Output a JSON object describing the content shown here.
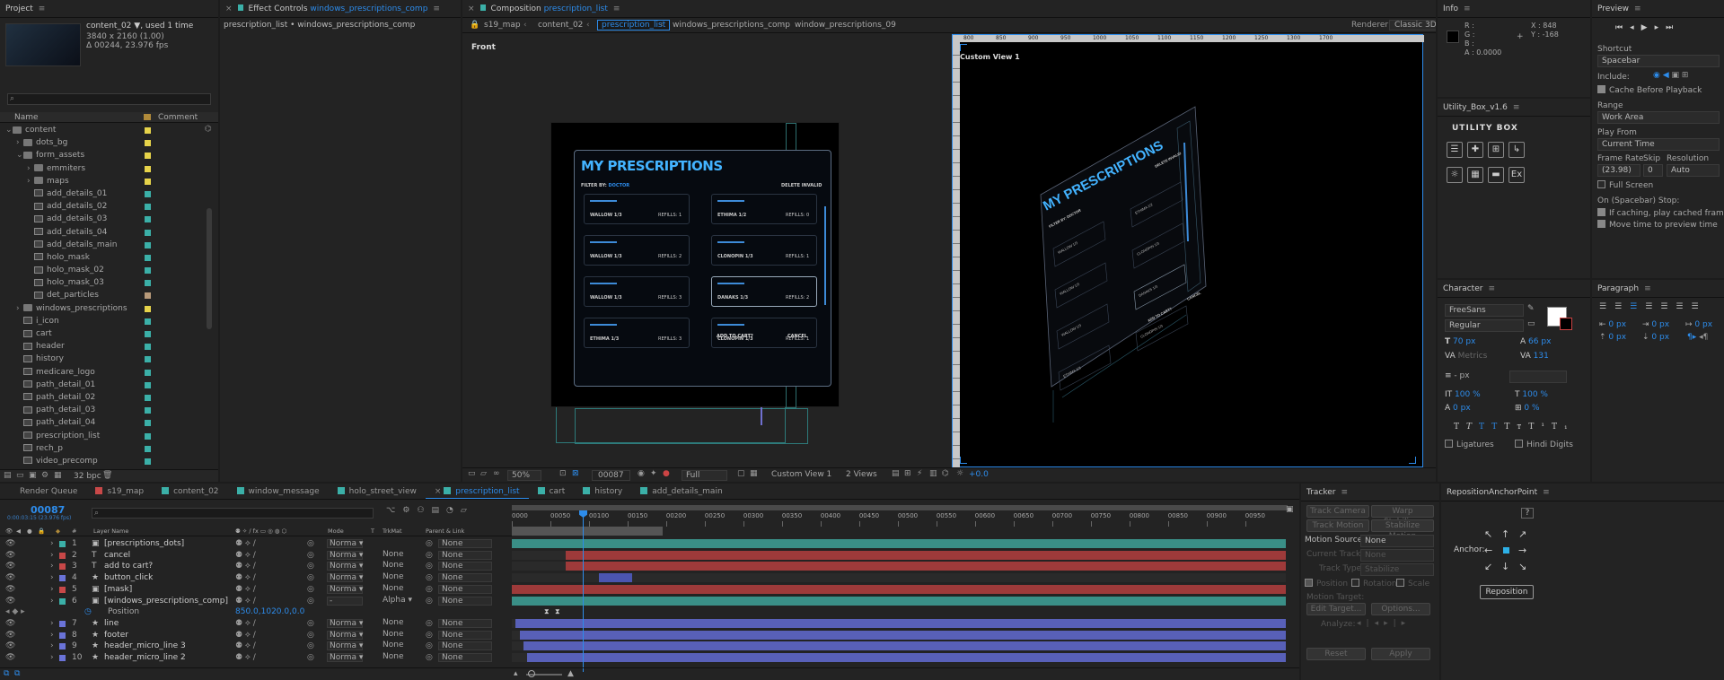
{
  "project": {
    "title": "Project",
    "item_name": "content_02 ▼",
    "used": ", used 1 time",
    "resolution": "3840 x 2160 (1.00)",
    "duration": "Δ 00244, 23.976 fps",
    "col_name": "Name",
    "col_comment": "Comment",
    "bpc": "32 bpc",
    "items": [
      {
        "label": "content",
        "indent": 0,
        "kind": "folder",
        "color": "#e6d34a",
        "open": true
      },
      {
        "label": "dots_bg",
        "indent": 1,
        "kind": "folder",
        "color": "#e6d34a"
      },
      {
        "label": "form_assets",
        "indent": 1,
        "kind": "folder",
        "color": "#e6d34a",
        "open": true
      },
      {
        "label": "emmiters",
        "indent": 2,
        "kind": "folder",
        "color": "#e6d34a"
      },
      {
        "label": "maps",
        "indent": 2,
        "kind": "folder",
        "color": "#e6d34a"
      },
      {
        "label": "add_details_01",
        "indent": 2,
        "kind": "comp",
        "color": "#3bb0a8"
      },
      {
        "label": "add_details_02",
        "indent": 2,
        "kind": "comp",
        "color": "#3bb0a8"
      },
      {
        "label": "add_details_03",
        "indent": 2,
        "kind": "comp",
        "color": "#3bb0a8"
      },
      {
        "label": "add_details_04",
        "indent": 2,
        "kind": "comp",
        "color": "#3bb0a8"
      },
      {
        "label": "add_details_main",
        "indent": 2,
        "kind": "comp",
        "color": "#3bb0a8"
      },
      {
        "label": "holo_mask",
        "indent": 2,
        "kind": "comp",
        "color": "#3bb0a8"
      },
      {
        "label": "holo_mask_02",
        "indent": 2,
        "kind": "comp",
        "color": "#3bb0a8"
      },
      {
        "label": "holo_mask_03",
        "indent": 2,
        "kind": "comp",
        "color": "#3bb0a8"
      },
      {
        "label": "det_particles",
        "indent": 2,
        "kind": "comp",
        "color": "#b89a7a"
      },
      {
        "label": "windows_prescriptions",
        "indent": 1,
        "kind": "folder",
        "color": "#e6d34a"
      },
      {
        "label": "i_icon",
        "indent": 1,
        "kind": "comp",
        "color": "#3bb0a8"
      },
      {
        "label": "cart",
        "indent": 1,
        "kind": "comp",
        "color": "#3bb0a8"
      },
      {
        "label": "header",
        "indent": 1,
        "kind": "comp",
        "color": "#3bb0a8"
      },
      {
        "label": "history",
        "indent": 1,
        "kind": "comp",
        "color": "#3bb0a8"
      },
      {
        "label": "medicare_logo",
        "indent": 1,
        "kind": "comp",
        "color": "#3bb0a8"
      },
      {
        "label": "path_detail_01",
        "indent": 1,
        "kind": "comp",
        "color": "#3bb0a8"
      },
      {
        "label": "path_detail_02",
        "indent": 1,
        "kind": "comp",
        "color": "#3bb0a8"
      },
      {
        "label": "path_detail_03",
        "indent": 1,
        "kind": "comp",
        "color": "#3bb0a8"
      },
      {
        "label": "path_detail_04",
        "indent": 1,
        "kind": "comp",
        "color": "#3bb0a8"
      },
      {
        "label": "prescription_list",
        "indent": 1,
        "kind": "comp",
        "color": "#3bb0a8"
      },
      {
        "label": "rech_p",
        "indent": 1,
        "kind": "comp",
        "color": "#3bb0a8"
      },
      {
        "label": "video_precomp",
        "indent": 1,
        "kind": "comp",
        "color": "#3bb0a8"
      }
    ]
  },
  "effect_controls": {
    "title": "Effect Controls",
    "comp": "windows_prescriptions_comp",
    "path": "prescription_list • windows_prescriptions_comp"
  },
  "composition": {
    "title": "Composition",
    "name": "prescription_list",
    "breadcrumbs": [
      "s19_map",
      "content_02",
      "prescription_list",
      "windows_prescriptions_comp",
      "window_prescriptions_09"
    ],
    "renderer_label": "Renderer",
    "renderer": "Classic 3D",
    "left_view": "Front",
    "right_view": "Custom View 1",
    "ruler": [
      "800",
      "850",
      "900",
      "950",
      "1000",
      "1050",
      "1100",
      "1150",
      "1200",
      "1250",
      "1300",
      "1700"
    ],
    "zoom": "50%",
    "frame": "00087",
    "quality": "Full",
    "view_select": "Custom View 1",
    "views": "2 Views",
    "exposure": "+0.0",
    "artwork": {
      "heading": "MY PRESCRIPTIONS",
      "filter": "FILTER BY:",
      "filter_value": "DOCTOR",
      "delete": "DELETE INVALID",
      "add_to_cart": "ADD TO CART?",
      "cancel": "CANCEL",
      "cards": [
        "WALLOW 1/3",
        "ETHIMA 1/2",
        "WALLOW 1/3",
        "CLONOPIN 1/3",
        "WALLOW 1/3",
        "DANAKS 1/3",
        "ETHIMA 1/3",
        "CLONOPIN 1/3"
      ],
      "refills": [
        "REFILLS: 1",
        "REFILLS: 0",
        "REFILLS: 2",
        "REFILLS: 1",
        "REFILLS: 3",
        "REFILLS: 2",
        "REFILLS: 3",
        "REFILLS: 1"
      ]
    }
  },
  "info": {
    "title": "Info",
    "r": "R :",
    "g": "G :",
    "b": "B :",
    "a": "A :",
    "a_val": "0.0000",
    "x": "X : 848",
    "y": "Y : -168"
  },
  "preview": {
    "title": "Preview",
    "shortcut_label": "Shortcut",
    "shortcut": "Spacebar",
    "include_label": "Include:",
    "cache": "Cache Before Playback",
    "range_label": "Range",
    "range": "Work Area",
    "play_from_label": "Play From",
    "play_from": "Current Time",
    "frame_rate_label": "Frame Rate",
    "skip_label": "Skip",
    "resolution_label": "Resolution",
    "frame_rate": "(23.98)",
    "skip": "0",
    "resolution": "Auto",
    "full_screen": "Full Screen",
    "on_stop": "On (Spacebar) Stop:",
    "if_caching": "If caching, play cached frames",
    "move_time": "Move time to preview time"
  },
  "utility": {
    "title": "Utility_Box_v1.6",
    "logo": "UTILITY BOX"
  },
  "character": {
    "title": "Character",
    "font": "FreeSans",
    "style": "Regular",
    "size": "70 px",
    "leading": "66 px",
    "kerning": "Metrics",
    "tracking": "131",
    "stroke": "- px",
    "vscale": "100 %",
    "hscale": "100 %",
    "baseline": "0 px",
    "tsume": "0 %",
    "ligatures": "Ligatures",
    "hindi": "Hindi Digits"
  },
  "paragraph": {
    "title": "Paragraph",
    "v1": "0 px",
    "v2": "0 px",
    "v3": "0 px",
    "v4": "0 px",
    "v5": "0 px"
  },
  "timeline": {
    "tabs": [
      {
        "label": "Render Queue",
        "color": ""
      },
      {
        "label": "s19_map",
        "color": "#c84848"
      },
      {
        "label": "content_02",
        "color": "#3bb0a8"
      },
      {
        "label": "window_message",
        "color": "#3bb0a8"
      },
      {
        "label": "holo_street_view",
        "color": "#3bb0a8"
      },
      {
        "label": "prescription_list",
        "color": "#3bb0a8",
        "active": true
      },
      {
        "label": "cart",
        "color": "#3bb0a8"
      },
      {
        "label": "history",
        "color": "#3bb0a8"
      },
      {
        "label": "add_details_main",
        "color": "#3bb0a8"
      }
    ],
    "timecode": "00087",
    "timecode_sub": "0:00:03:15 (23.976 fps)",
    "col_layer": "Layer Name",
    "col_mode": "Mode",
    "col_t": "T",
    "col_trkmat": "TrkMat",
    "col_parent": "Parent & Link",
    "time_marks": [
      "0000",
      "00050",
      "00100",
      "00150",
      "00200",
      "00250",
      "00300",
      "00350",
      "00400",
      "00450",
      "00500",
      "00550",
      "00600",
      "00650",
      "00700",
      "00750",
      "00800",
      "00850",
      "00900",
      "00950"
    ],
    "layers": [
      {
        "num": "1",
        "name": "[prescriptions_dots]",
        "color": "#3bb0a8",
        "mode": "Norma ▾",
        "trk": "",
        "parent": "None",
        "bar": "#3a8f87",
        "start": 0.0,
        "end": 1.0
      },
      {
        "num": "2",
        "name": "cancel",
        "color": "#c84848",
        "mode": "Norma ▾",
        "trk": "None",
        "parent": "None",
        "bar": "#9e3a3a",
        "start": 0.07,
        "end": 1.0
      },
      {
        "num": "3",
        "name": "add to cart?",
        "color": "#c84848",
        "mode": "Norma ▾",
        "trk": "None",
        "parent": "None",
        "bar": "#9e3a3a",
        "start": 0.07,
        "end": 1.0
      },
      {
        "num": "4",
        "name": "button_click",
        "color": "#6a73d8",
        "mode": "Norma ▾",
        "trk": "None",
        "parent": "None",
        "bar": "#4b55b0",
        "start": 0.112,
        "end": 0.155
      },
      {
        "num": "5",
        "name": "[mask]",
        "color": "#c84848",
        "mode": "Norma ▾",
        "trk": "None",
        "parent": "None",
        "bar": "#9e3a3a",
        "start": 0.0,
        "end": 1.0
      },
      {
        "num": "6",
        "name": "[windows_prescriptions_comp]",
        "color": "#3bb0a8",
        "mode": "-",
        "trk": "Alpha ▾",
        "parent": "None",
        "bar": "#3a8f87",
        "start": 0.0,
        "end": 1.0
      },
      {
        "num": "",
        "name": "Position",
        "color": "",
        "mode": "",
        "trk": "",
        "parent": "",
        "value": "850.0,1020.0,0.0",
        "bar": "",
        "start": 0,
        "end": 0
      },
      {
        "num": "7",
        "name": "line",
        "color": "#6a73d8",
        "mode": "Norma ▾",
        "trk": "None",
        "parent": "None",
        "bar": "#5860b8",
        "start": 0.005,
        "end": 1.0
      },
      {
        "num": "8",
        "name": "footer",
        "color": "#6a73d8",
        "mode": "Norma ▾",
        "trk": "None",
        "parent": "None",
        "bar": "#5860b8",
        "start": 0.01,
        "end": 1.0
      },
      {
        "num": "9",
        "name": "header_micro_line 3",
        "color": "#6a73d8",
        "mode": "Norma ▾",
        "trk": "None",
        "parent": "None",
        "bar": "#5860b8",
        "start": 0.015,
        "end": 1.0
      },
      {
        "num": "10",
        "name": "header_micro_line 2",
        "color": "#6a73d8",
        "mode": "Norma ▾",
        "trk": "None",
        "parent": "None",
        "bar": "#5860b8",
        "start": 0.02,
        "end": 1.0
      }
    ]
  },
  "tracker": {
    "title": "Tracker",
    "track_camera": "Track Camera",
    "warp": "Warp Stabilizer",
    "track_motion": "Track Motion",
    "stabilize": "Stabilize Motion",
    "motion_source_label": "Motion Source:",
    "motion_source": "None",
    "current_track_label": "Current Track:",
    "current_track": "None",
    "track_type_label": "Track Type:",
    "track_type": "Stabilize",
    "position": "Position",
    "rotation": "Rotation",
    "scale": "Scale",
    "motion_target": "Motion Target:",
    "edit_target": "Edit Target...",
    "options": "Options...",
    "analyze": "Analyze:",
    "reset": "Reset",
    "apply": "Apply"
  },
  "reposition": {
    "title": "RepositionAnchorPoint",
    "help": "?",
    "anchor": "Anchor:",
    "button": "Reposition"
  }
}
